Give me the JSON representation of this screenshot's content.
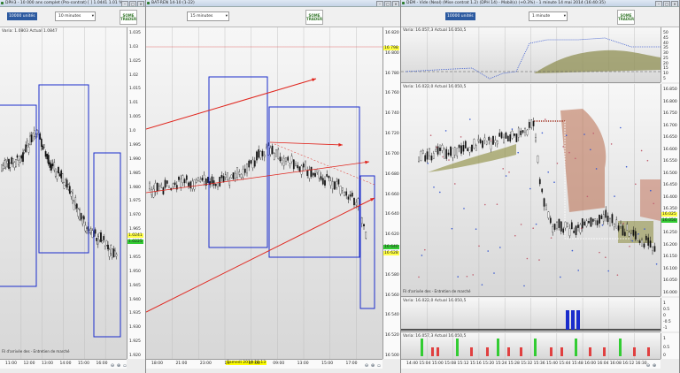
{
  "colors": {
    "accent": "#2c5aa0",
    "box": "#1a2ccc",
    "arrow": "#e0241c",
    "price_up": "#1a1a1a",
    "tag_green": "#33cc33",
    "tag_yellow": "#ffff44",
    "tag_red": "#ff3333"
  },
  "windows": [
    {
      "title": "DPH3 - 10 000 ans complet (Pro-contrat) [ ] 1.0441 1.01 %",
      "tf_box": "10000 unités",
      "tf_select": "10 minutes",
      "logo": "SOME TRADER",
      "plot_title": "Varia: 1.0803 Actual 1.0847",
      "y_ticks": [
        "1.035",
        "1.03",
        "1.025",
        "1.02",
        "1.015",
        "1.01",
        "1.005",
        "1.0",
        "1.995",
        "1.990",
        "1.985",
        "1.980",
        "1.975",
        "1.970",
        "1.965",
        "1.960",
        "1.955",
        "1.950",
        "1.945",
        "1.940",
        "1.935",
        "1.930",
        "1.925",
        "1.920"
      ],
      "price_tags": [
        {
          "text": "1.0241",
          "color": "tag_yellow"
        },
        {
          "text": "1.0225",
          "color": "tag_green"
        }
      ],
      "x_ticks": [
        "11:00",
        "12:00",
        "13:00",
        "14:00",
        "15:00",
        "16:00"
      ],
      "footer": "Fil d'arrivée des - Entretien de marché"
    },
    {
      "title": "BAT-REN 14-10 (1-22)",
      "tf_select": "15 minutes",
      "logo": "SOME TRADER",
      "y_ticks": [
        "16 820",
        "16 800",
        "16 780",
        "16 760",
        "16 740",
        "16 720",
        "16 700",
        "16 680",
        "16 660",
        "16 640",
        "16 620",
        "16 600",
        "16 580",
        "16 560",
        "16 540",
        "16 520",
        "16 500"
      ],
      "price_tags": [
        {
          "text": "16 798",
          "color": "tag_yellow"
        },
        {
          "text": "16 640",
          "color": "tag_green"
        },
        {
          "text": "16 628",
          "color": "tag_yellow"
        }
      ],
      "x_ticks": [
        "18:00",
        "21:00",
        "23:00",
        "14",
        "07:00",
        "09:00",
        "13:00",
        "15:00",
        "17:00"
      ],
      "highlight": "Samedi 2014.10.13"
    },
    {
      "title": "DEM - Vide (Neal) (Mise contrat 1.2) (DPH 14) - Mobil(s) (+0.3%) - 1 minute 14 mai 2014 (16:40:35)",
      "tf_box": "10000 unités",
      "tf_select": "1 minute",
      "logo": "SOME TRADER",
      "plot1_title": "Varia: 16.057,3 Actual 16.050,5",
      "plot1_ticks": [
        "50",
        "45",
        "40",
        "35",
        "30",
        "25",
        "20",
        "15",
        "10",
        "5"
      ],
      "plot2_title": "Varia: 16.022,0 Actual 16.050,5",
      "plot2_ticks": [
        "16.850",
        "16.800",
        "16.750",
        "16.700",
        "16.650",
        "16.600",
        "16.550",
        "16.500",
        "16.450",
        "16.400",
        "16.350",
        "16.300",
        "16.250",
        "16.200",
        "16.150",
        "16.100",
        "16.050",
        "16.000"
      ],
      "plot2_tags": [
        {
          "text": "16.025",
          "color": "tag_yellow"
        },
        {
          "text": "16.050",
          "color": "tag_green"
        }
      ],
      "plot3_title": "Varia: 16.022,0 Actual 16.050,5",
      "plot3_ticks": [
        "1",
        "0.5",
        "0",
        "-0.5",
        "-1"
      ],
      "plot4_title": "Varia: 16.057,3 Actual 16.050,5",
      "plot4_ticks": [
        "1",
        "0.5",
        "0"
      ],
      "x_ticks": [
        "14:40",
        "15:04",
        "15:00",
        "15:08",
        "15:12",
        "15:16",
        "15:20",
        "15:24",
        "15:28",
        "15:32",
        "15:36",
        "15:40",
        "15:44",
        "15:48",
        "16:00",
        "16:04",
        "16:08",
        "16:12",
        "16:30"
      ],
      "footer": "Fil d'arrivée des - Entretien de marché"
    }
  ]
}
